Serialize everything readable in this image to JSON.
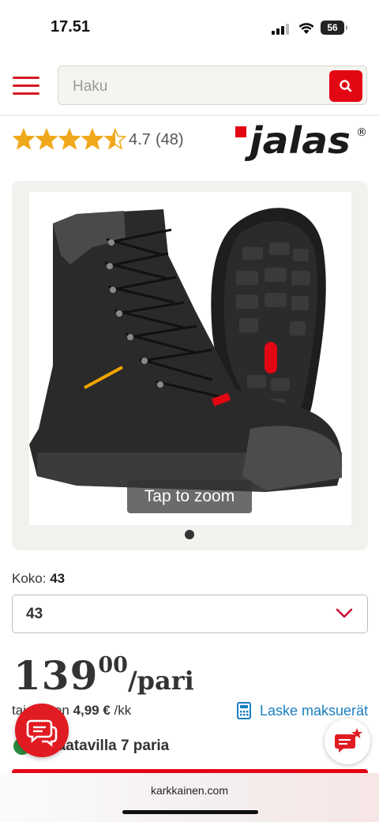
{
  "status_bar": {
    "time": "17.51",
    "battery": "56"
  },
  "header": {
    "search_placeholder": "Haku"
  },
  "rating": {
    "value": "4.7",
    "count": "(48)",
    "stars": 4.5
  },
  "brand": {
    "name": "jalas",
    "mark": "®"
  },
  "gallery": {
    "zoom_label": "Tap to zoom",
    "image_count": 1,
    "active_index": 0
  },
  "size": {
    "label": "Koko:",
    "current": "43",
    "selected": "43"
  },
  "price": {
    "integer": "139",
    "decimals": "00",
    "unit": "/pari"
  },
  "installment": {
    "prefix": "tai alkaen",
    "amount": "4,99 €",
    "suffix": "/kk"
  },
  "calculator": {
    "label": "Laske maksuerät"
  },
  "stock": {
    "text": "Saatavilla 7 paria"
  },
  "browser": {
    "url": "karkkainen.com"
  },
  "colors": {
    "brand_red": "#e30613",
    "link_blue": "#1a7fc1",
    "stock_green": "#2d8a3f"
  }
}
